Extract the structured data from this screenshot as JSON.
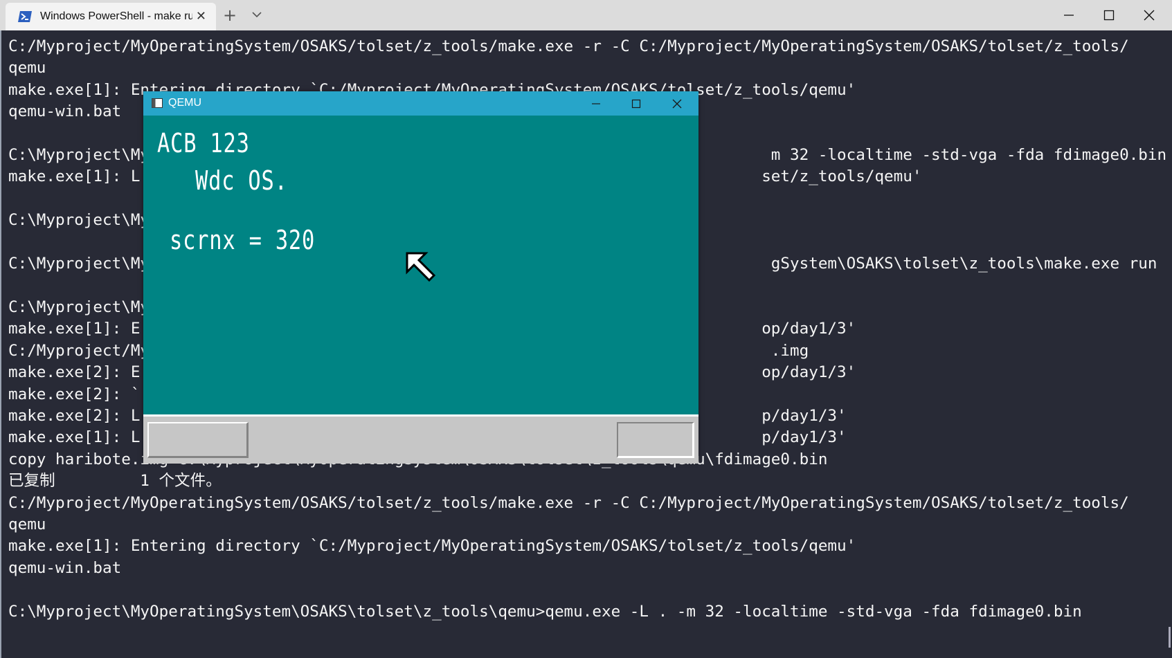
{
  "window": {
    "tab_title": "Windows PowerShell - make  ru",
    "tab_close": "✕",
    "new_tab": "+"
  },
  "terminal": {
    "lines": [
      "C:/Myproject/MyOperatingSystem/OSAKS/tolset/z_tools/make.exe -r -C C:/Myproject/MyOperatingSystem/OSAKS/tolset/z_tools/",
      "qemu",
      "make.exe[1]: Entering directory `C:/Myproject/MyOperatingSystem/OSAKS/tolset/z_tools/qemu'",
      "qemu-win.bat",
      "",
      "C:\\Myproject\\My                                                                  m 32 -localtime -std-vga -fda fdimage0.bin",
      "make.exe[1]: L                                                                  set/z_tools/qemu'",
      "",
      "C:\\Myproject\\My",
      "",
      "C:\\Myproject\\My                                                                  gSystem\\OSAKS\\tolset\\z_tools\\make.exe run",
      "",
      "C:\\Myproject\\My",
      "make.exe[1]: E                                                                  op/day1/3'",
      "C:/Myproject/My                                                                  .img",
      "make.exe[2]: E                                                                  op/day1/3'",
      "make.exe[2]: `",
      "make.exe[2]: L                                                                  p/day1/3'",
      "make.exe[1]: L                                                                  p/day1/3'",
      "copy haribote.img C:\\Myproject\\MyOperatingSystem\\OSAKS\\tolset\\z_tools\\qemu\\fdimage0.bin",
      "已复制         1 个文件。",
      "C:/Myproject/MyOperatingSystem/OSAKS/tolset/z_tools/make.exe -r -C C:/Myproject/MyOperatingSystem/OSAKS/tolset/z_tools/",
      "qemu",
      "make.exe[1]: Entering directory `C:/Myproject/MyOperatingSystem/OSAKS/tolset/z_tools/qemu'",
      "qemu-win.bat",
      "",
      "C:\\Myproject\\MyOperatingSystem\\OSAKS\\tolset\\z_tools\\qemu>qemu.exe -L . -m 32 -localtime -std-vga -fda fdimage0.bin"
    ]
  },
  "qemu": {
    "title": "QEMU",
    "screen": {
      "line1": "ACB 123",
      "line2": "Wdc OS.",
      "line3": "scrnx = 320"
    },
    "colors": {
      "desktop": "#008484",
      "titlebar": "#27a5c9"
    }
  }
}
